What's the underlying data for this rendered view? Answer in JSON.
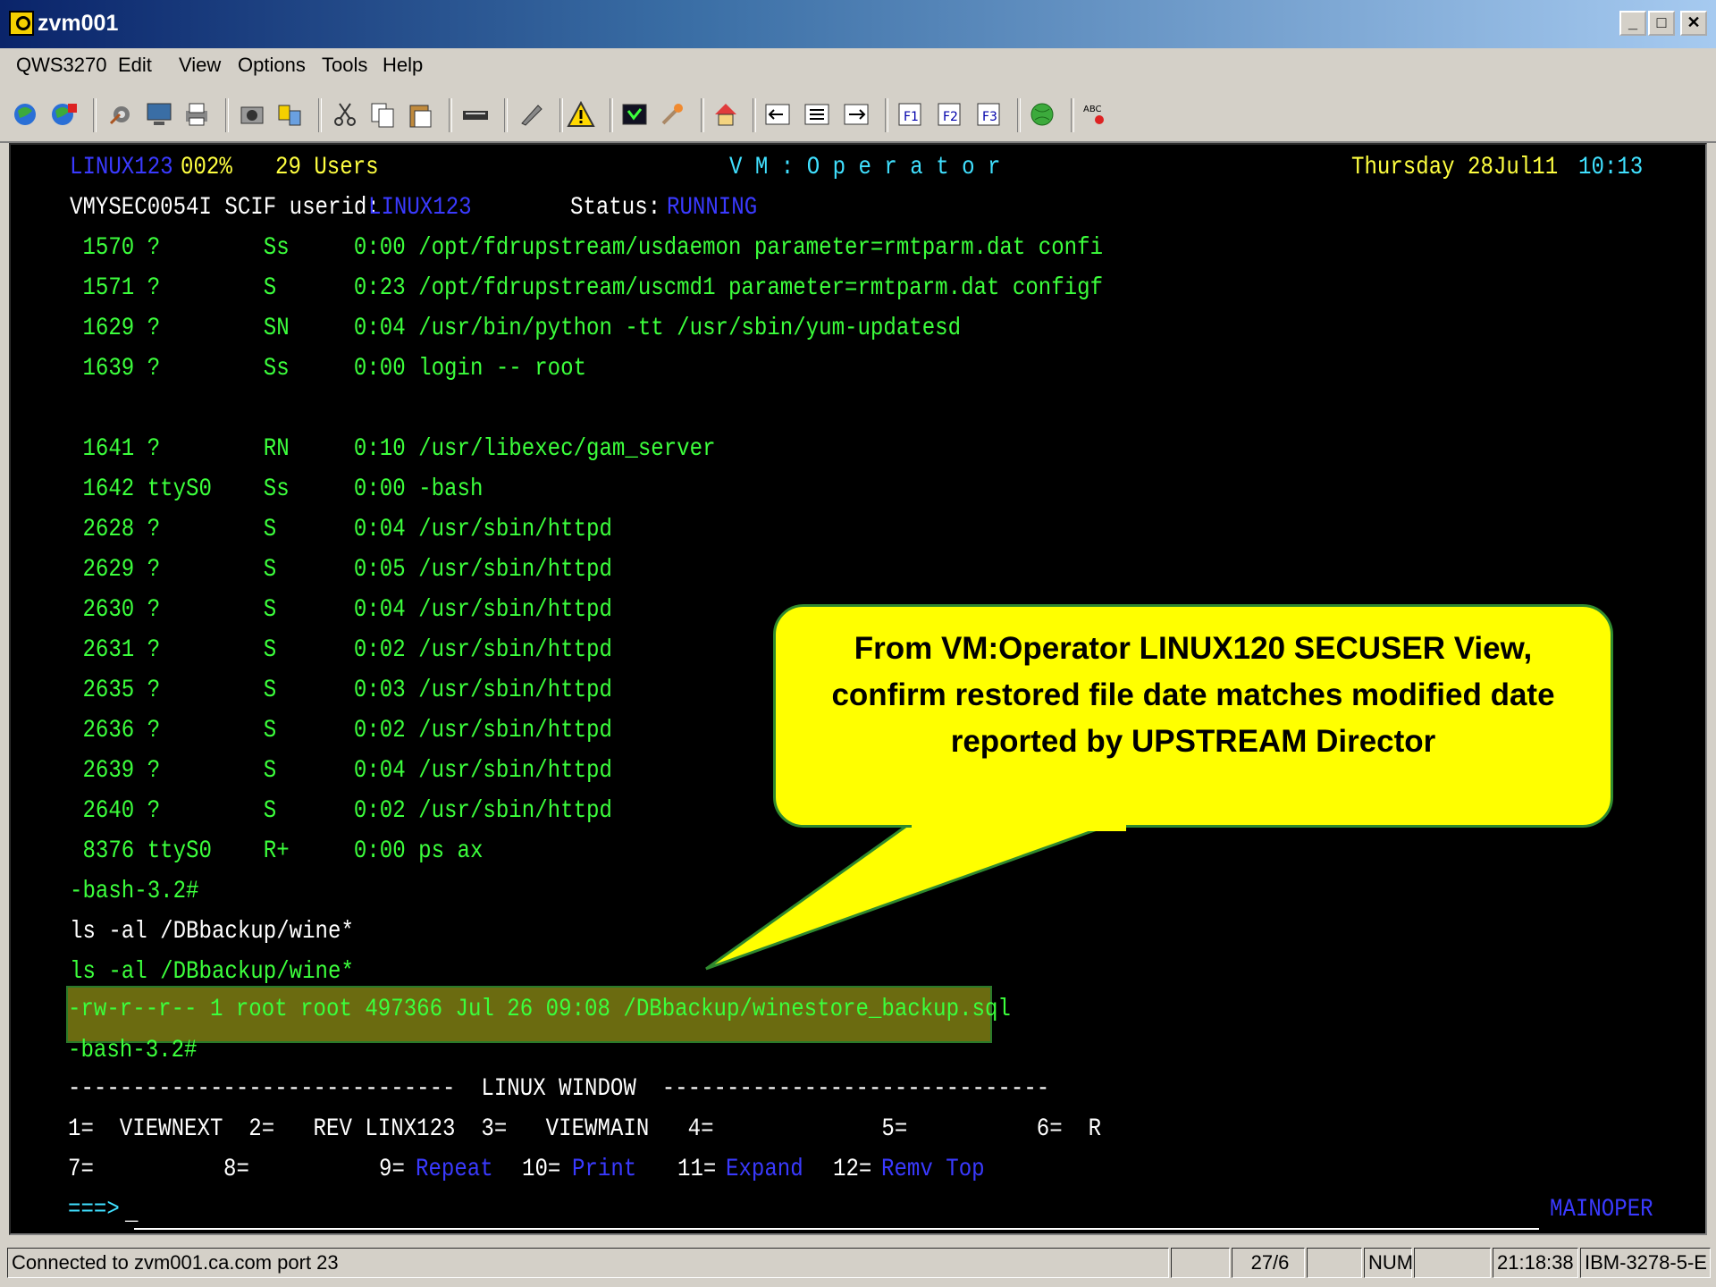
{
  "window": {
    "title": "zvm001"
  },
  "menu": [
    "QWS3270",
    "Edit",
    "View",
    "Options",
    "Tools",
    "Help"
  ],
  "toolbar_icons": [
    "connect-icon",
    "disconnect-icon",
    "macro-icon",
    "display-icon",
    "print-icon",
    "capture-icon",
    "transfer-icon",
    "cut-icon",
    "copy-icon",
    "paste-icon",
    "keyboard-icon",
    "settings-icon",
    "alert-icon",
    "terminal-icon",
    "tool-icon",
    "home-icon",
    "field-prev-icon",
    "field-list-icon",
    "field-next-icon",
    "f1-icon",
    "f2-icon",
    "f3-icon",
    "globe-icon",
    "spell-icon"
  ],
  "terminal": {
    "header": {
      "system": "LINUX123",
      "pct": "002%",
      "users": "29 Users",
      "product": "V M : O p e r a t o r",
      "date": "Thursday 28Jul11",
      "time": "10:13"
    },
    "secuser": {
      "prefix": "VMYSEC0054I SCIF userid:",
      "userid": "LINUX123",
      "status_label": "Status:",
      "status": "RUNNING"
    },
    "lines": [
      " 1570 ?        Ss     0:00 /opt/fdrupstream/usdaemon parameter=rmtparm.dat confi",
      " 1571 ?        S      0:23 /opt/fdrupstream/uscmd1 parameter=rmtparm.dat configf",
      " 1629 ?        SN     0:04 /usr/bin/python -tt /usr/sbin/yum-updatesd",
      " 1639 ?        Ss     0:00 login -- root",
      "",
      " 1641 ?        RN     0:10 /usr/libexec/gam_server",
      " 1642 ttyS0    Ss     0:00 -bash",
      " 2628 ?        S      0:04 /usr/sbin/httpd",
      " 2629 ?        S      0:05 /usr/sbin/httpd",
      " 2630 ?        S      0:04 /usr/sbin/httpd",
      " 2631 ?        S      0:02 /usr/sbin/httpd",
      " 2635 ?        S      0:03 /usr/sbin/httpd",
      " 2636 ?        S      0:02 /usr/sbin/httpd",
      " 2639 ?        S      0:04 /usr/sbin/httpd",
      " 2640 ?        S      0:02 /usr/sbin/httpd",
      " 8376 ttyS0    R+     0:00 ps ax",
      "-bash-3.2#"
    ],
    "cmd_echo": "ls -al /DBbackup/wine*",
    "cmd_green": "ls -al /DBbackup/wine*",
    "result": "-rw-r--r-- 1 root root 497366 Jul 26 09:08 /DBbackup/winestore_backup.sql",
    "prompt": "-bash-3.2#",
    "divider": "------------------------------  LINUX WINDOW  ------------------------------",
    "pf_row1": "1=  VIEWNEXT  2=   REV LINX123  3=   VIEWMAIN   4=             5=          6=  R",
    "pf_row2": {
      "k7": "7=",
      "k8": "8=",
      "k9": "9=",
      "v9": "Repeat",
      "k10": "10=",
      "v10": "Print",
      "k11": "11=",
      "v11": "Expand",
      "k12": "12=",
      "v12": "Remv Top"
    },
    "cmd_prompt": "===>",
    "cmd_cursor": "_",
    "mainoper": "MAINOPER"
  },
  "callout": {
    "line1": "From VM:Operator LINUX120 SECUSER View,",
    "line2": "confirm restored file date matches modified date",
    "line3": "reported by UPSTREAM Director"
  },
  "status_bar": {
    "connection": "Connected to zvm001.ca.com port 23",
    "cursor_pos": "27/6",
    "num": "NUM",
    "clock": "21:18:38",
    "terminal_type": "IBM-3278-5-E"
  },
  "colors": {
    "terminal_green": "#3cff3c",
    "terminal_bg": "#000000",
    "callout_fill": "#ffff00",
    "highlight": "#6b6b10"
  }
}
